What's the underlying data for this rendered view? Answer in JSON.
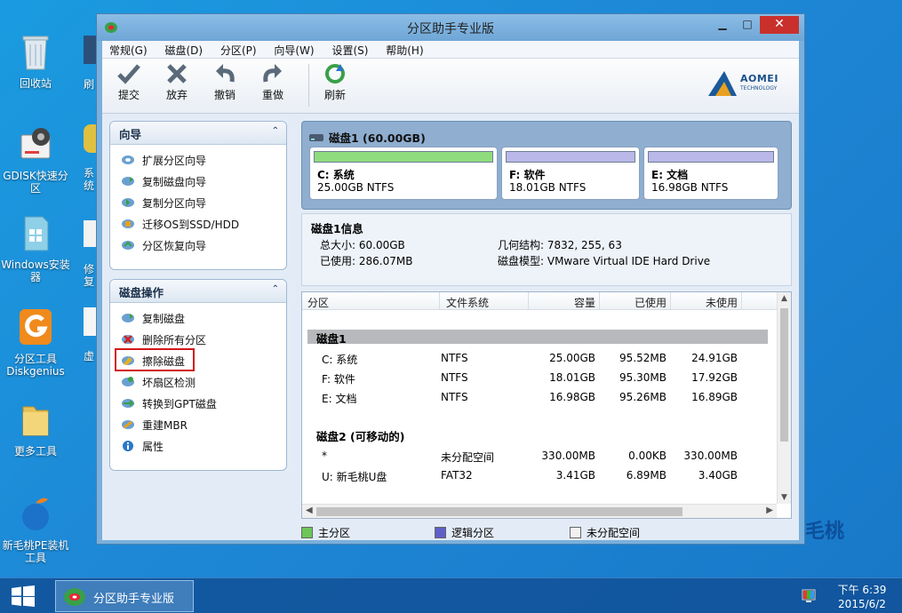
{
  "desktop": {
    "icons": [
      {
        "label": "回收站"
      },
      {
        "label": "GDISK快速分区"
      },
      {
        "label": "Windows安装器"
      },
      {
        "label": "分区工具Diskgenius"
      },
      {
        "label": "更多工具"
      },
      {
        "label": "新毛桃PE装机工具"
      }
    ],
    "partial_icons": [
      {
        "label": "刷"
      },
      {
        "label": "系统"
      },
      {
        "label": "修复"
      },
      {
        "label": "虚"
      }
    ],
    "watermark": "毛桃"
  },
  "window": {
    "title": "分区助手专业版",
    "controls": {
      "minimize": "▁",
      "maximize": "□",
      "close": "✕"
    },
    "menu": [
      "常规(G)",
      "磁盘(D)",
      "分区(P)",
      "向导(W)",
      "设置(S)",
      "帮助(H)"
    ],
    "toolbar": {
      "commit": "提交",
      "discard": "放弃",
      "undo": "撤销",
      "redo": "重做",
      "refresh": "刷新"
    },
    "logo": {
      "brand": "AOMEI",
      "sub": "TECHNOLOGY"
    }
  },
  "wizard_panel": {
    "title": "向导",
    "collapse": "⌃",
    "items": [
      "扩展分区向导",
      "复制磁盘向导",
      "复制分区向导",
      "迁移OS到SSD/HDD",
      "分区恢复向导"
    ]
  },
  "disk_ops_panel": {
    "title": "磁盘操作",
    "collapse": "⌃",
    "items": [
      "复制磁盘",
      "删除所有分区",
      "擦除磁盘",
      "坏扇区检测",
      "转换到GPT磁盘",
      "重建MBR",
      "属性"
    ]
  },
  "disk_map": {
    "label": "磁盘1 (60.00GB)",
    "partitions": [
      {
        "name": "C: 系统",
        "detail": "25.00GB NTFS",
        "color": "#8fdc7e"
      },
      {
        "name": "F: 软件",
        "detail": "18.01GB NTFS",
        "color": "#b9b8e8"
      },
      {
        "name": "E: 文档",
        "detail": "16.98GB NTFS",
        "color": "#b9b8e8"
      }
    ]
  },
  "disk_info": {
    "title": "磁盘1信息",
    "total_size": "总大小: 60.00GB",
    "used": "已使用: 286.07MB",
    "geometry": "几何结构: 7832, 255, 63",
    "model": "磁盘模型: VMware Virtual IDE Hard Drive"
  },
  "table": {
    "columns": [
      "分区",
      "文件系统",
      "容量",
      "已使用",
      "未使用"
    ],
    "groups": [
      {
        "name": "磁盘1",
        "rows": [
          [
            "C: 系统",
            "NTFS",
            "25.00GB",
            "95.52MB",
            "24.91GB"
          ],
          [
            "F: 软件",
            "NTFS",
            "18.01GB",
            "95.30MB",
            "17.92GB"
          ],
          [
            "E: 文档",
            "NTFS",
            "16.98GB",
            "95.26MB",
            "16.89GB"
          ]
        ]
      },
      {
        "name": "磁盘2 (可移动的)",
        "rows": [
          [
            "*",
            "未分配空间",
            "330.00MB",
            "0.00KB",
            "330.00MB"
          ],
          [
            "U: 新毛桃U盘",
            "FAT32",
            "3.41GB",
            "6.89MB",
            "3.40GB"
          ]
        ]
      }
    ]
  },
  "legend": {
    "primary": "主分区",
    "logical": "逻辑分区",
    "unallocated": "未分配空间",
    "colors": {
      "primary": "#6cc65a",
      "logical": "#5f5fc8",
      "unallocated": "#f2f2f2"
    }
  },
  "taskbar": {
    "app": "分区助手专业版",
    "time": "下午 6:39",
    "date": "2015/6/2"
  }
}
